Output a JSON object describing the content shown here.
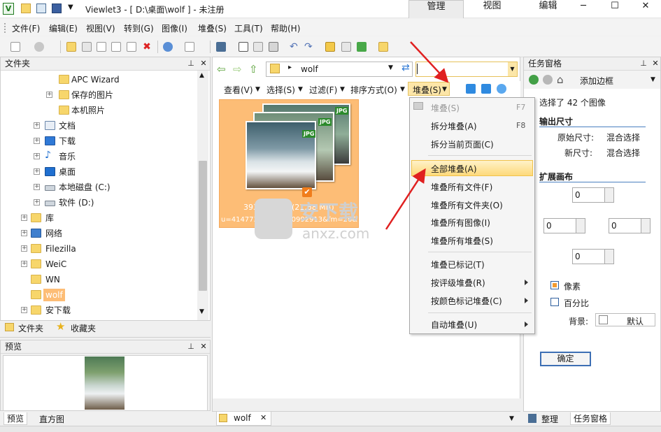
{
  "titlebar": {
    "app_icon": "V",
    "title": "Viewlet3 - [ D:\\桌面\\wolf ] - 未注册",
    "tabs": [
      "管理",
      "视图",
      "编辑"
    ],
    "window_buttons": [
      "─",
      "☐",
      "✕"
    ]
  },
  "menubar": {
    "items": [
      "文件(F)",
      "编辑(E)",
      "视图(V)",
      "转到(G)",
      "图像(I)",
      "堆叠(S)",
      "工具(T)",
      "帮助(H)"
    ]
  },
  "folder_panel": {
    "title": "文件夹",
    "tree": [
      {
        "label": "APC Wizard"
      },
      {
        "label": "保存的图片"
      },
      {
        "label": "本机照片"
      },
      {
        "label": "文档"
      },
      {
        "label": "下载"
      },
      {
        "label": "音乐"
      },
      {
        "label": "桌面"
      },
      {
        "label": "本地磁盘 (C:)"
      },
      {
        "label": "软件 (D:)"
      },
      {
        "label": "库"
      },
      {
        "label": "网络"
      },
      {
        "label": "Filezilla"
      },
      {
        "label": "WeiC"
      },
      {
        "label": "WN"
      },
      {
        "label": "wolf"
      },
      {
        "label": "安下载"
      }
    ],
    "bottom_tabs": [
      "文件夹",
      "收藏夹"
    ]
  },
  "preview_panel": {
    "title": "预览",
    "bottom_tabs": [
      "预览",
      "直方图"
    ]
  },
  "center": {
    "address": "wolf",
    "subtoolbar": [
      "查看(V)",
      "选择(S)",
      "过滤(F)",
      "排序方式(O)",
      "堆叠(S)"
    ],
    "thumbnail": {
      "badges": [
        "JPG",
        "JPG",
        "JPG"
      ],
      "dims": "393x454x24(21.68 MB)",
      "filename": "u=4147730538,1170992913&fm=26&"
    },
    "doc_tab": "wolf"
  },
  "stack_menu": {
    "items": [
      {
        "label": "堆叠(S)",
        "shortcut": "F7",
        "disabled": true
      },
      {
        "label": "拆分堆叠(A)",
        "shortcut": "F8"
      },
      {
        "label": "拆分当前页面(C)",
        "shortcut": ""
      },
      {
        "label": "全部堆叠(A)",
        "shortcut": "",
        "highlighted": true
      },
      {
        "label": "堆叠所有文件(F)",
        "shortcut": ""
      },
      {
        "label": "堆叠所有文件夹(O)",
        "shortcut": ""
      },
      {
        "label": "堆叠所有图像(I)",
        "shortcut": ""
      },
      {
        "label": "堆叠所有堆叠(S)",
        "shortcut": ""
      },
      {
        "label": "堆叠已标记(T)",
        "shortcut": ""
      },
      {
        "label": "按评级堆叠(R)",
        "shortcut": "",
        "submenu": true
      },
      {
        "label": "按颜色标记堆叠(C)",
        "shortcut": "",
        "submenu": true
      },
      {
        "label": "自动堆叠(U)",
        "shortcut": "",
        "submenu": true
      }
    ]
  },
  "task_panel": {
    "title": "任务窗格",
    "tool_label": "添加边框",
    "selected_text": "选择了 42 个图像",
    "output_size": {
      "heading": "输出尺寸",
      "original_label": "原始尺寸:",
      "original_value": "混合选择",
      "new_label": "新尺寸:",
      "new_value": "混合选择"
    },
    "extend_canvas": {
      "heading": "扩展画布",
      "top": "0",
      "left": "0",
      "right": "0",
      "bottom": "0"
    },
    "units": {
      "pixel": "像素",
      "percent": "百分比",
      "selected": "pixel"
    },
    "background_label": "背景:",
    "background_value": "默认",
    "ok_button": "确定",
    "bottom_tabs": [
      "整理",
      "任务窗格"
    ]
  },
  "watermark": {
    "cn": "安下载",
    "en": "anxz.com"
  },
  "colors": {
    "accent_orange": "#fdbd76",
    "menu_highlight": "#fdd97a",
    "annotation_red": "#e02020",
    "link_blue": "#2f5f9e"
  }
}
